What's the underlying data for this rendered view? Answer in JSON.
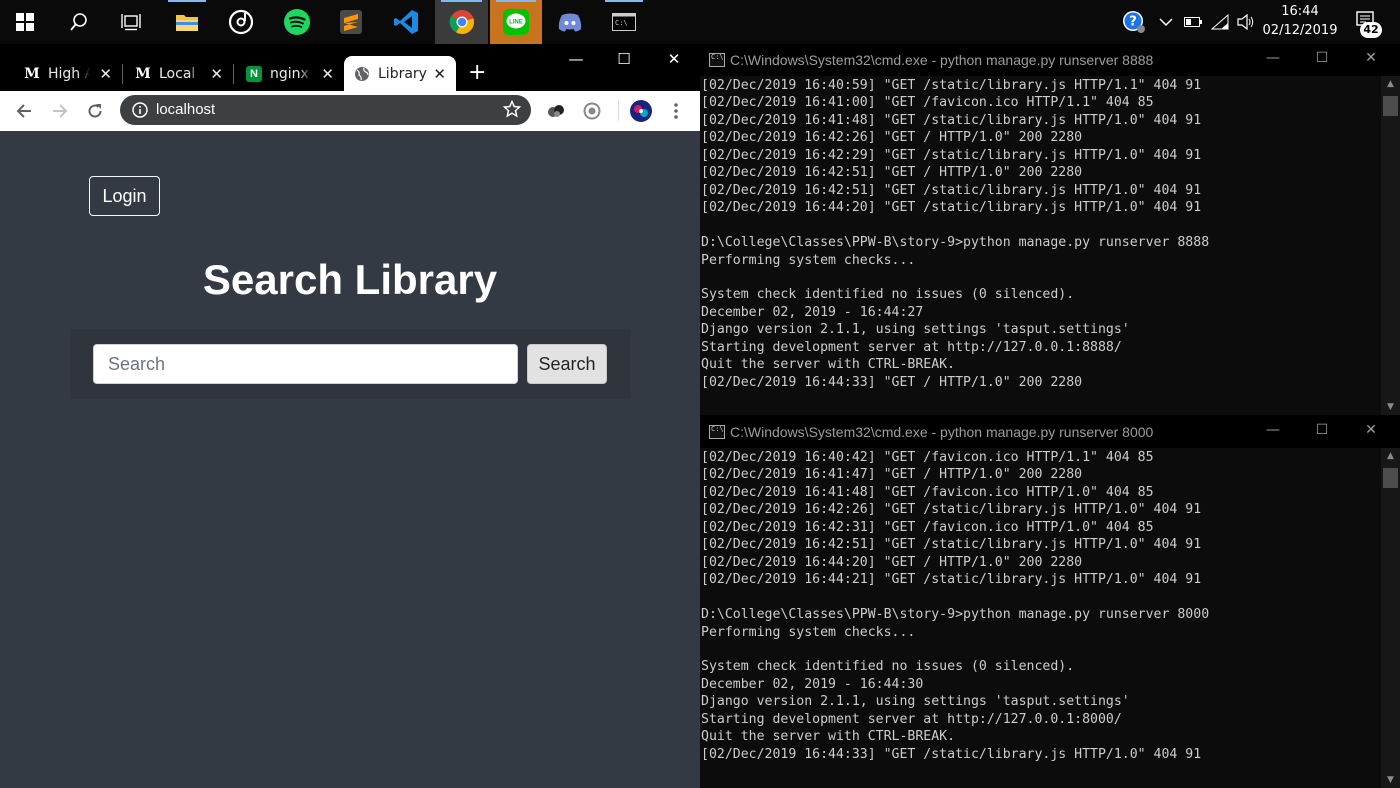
{
  "taskbar": {
    "clock_time": "16:44",
    "clock_date": "02/12/2019",
    "notification_count": "42"
  },
  "browser": {
    "tabs": [
      {
        "label": "High A",
        "favicon": "M"
      },
      {
        "label": "Local S",
        "favicon": "M"
      },
      {
        "label": "nginx f",
        "favicon": "N"
      },
      {
        "label": "Library",
        "favicon": "globe"
      }
    ],
    "active_tab_index": 3,
    "address": "localhost"
  },
  "page": {
    "login_label": "Login",
    "title": "Search Library",
    "search_placeholder": "Search",
    "search_button_label": "Search"
  },
  "consoles": [
    {
      "title": "C:\\Windows\\System32\\cmd.exe - python  manage.py runserver 8888",
      "lines": [
        "[02/Dec/2019 16:40:59] \"GET /static/library.js HTTP/1.1\" 404 91",
        "[02/Dec/2019 16:41:00] \"GET /favicon.ico HTTP/1.1\" 404 85",
        "[02/Dec/2019 16:41:48] \"GET /static/library.js HTTP/1.0\" 404 91",
        "[02/Dec/2019 16:42:26] \"GET / HTTP/1.0\" 200 2280",
        "[02/Dec/2019 16:42:29] \"GET /static/library.js HTTP/1.0\" 404 91",
        "[02/Dec/2019 16:42:51] \"GET / HTTP/1.0\" 200 2280",
        "[02/Dec/2019 16:42:51] \"GET /static/library.js HTTP/1.0\" 404 91",
        "[02/Dec/2019 16:44:20] \"GET /static/library.js HTTP/1.0\" 404 91",
        "",
        "D:\\College\\Classes\\PPW-B\\story-9>python manage.py runserver 8888",
        "Performing system checks...",
        "",
        "System check identified no issues (0 silenced).",
        "December 02, 2019 - 16:44:27",
        "Django version 2.1.1, using settings 'tasput.settings'",
        "Starting development server at http://127.0.0.1:8888/",
        "Quit the server with CTRL-BREAK.",
        "[02/Dec/2019 16:44:33] \"GET / HTTP/1.0\" 200 2280"
      ]
    },
    {
      "title": "C:\\Windows\\System32\\cmd.exe - python  manage.py runserver 8000",
      "lines": [
        "[02/Dec/2019 16:40:42] \"GET /favicon.ico HTTP/1.1\" 404 85",
        "[02/Dec/2019 16:41:47] \"GET / HTTP/1.0\" 200 2280",
        "[02/Dec/2019 16:41:48] \"GET /favicon.ico HTTP/1.0\" 404 85",
        "[02/Dec/2019 16:42:26] \"GET /static/library.js HTTP/1.0\" 404 91",
        "[02/Dec/2019 16:42:31] \"GET /favicon.ico HTTP/1.0\" 404 85",
        "[02/Dec/2019 16:42:51] \"GET /static/library.js HTTP/1.0\" 404 91",
        "[02/Dec/2019 16:44:20] \"GET / HTTP/1.0\" 200 2280",
        "[02/Dec/2019 16:44:21] \"GET /static/library.js HTTP/1.0\" 404 91",
        "",
        "D:\\College\\Classes\\PPW-B\\story-9>python manage.py runserver 8000",
        "Performing system checks...",
        "",
        "System check identified no issues (0 silenced).",
        "December 02, 2019 - 16:44:30",
        "Django version 2.1.1, using settings 'tasput.settings'",
        "Starting development server at http://127.0.0.1:8000/",
        "Quit the server with CTRL-BREAK.",
        "[02/Dec/2019 16:44:33] \"GET /static/library.js HTTP/1.0\" 404 91"
      ]
    }
  ],
  "colors": {
    "page_bg": "#343a43",
    "console_bg": "#0c0c0c",
    "console_text": "#cccccc",
    "taskbar_bg": "#0a0a0a"
  }
}
